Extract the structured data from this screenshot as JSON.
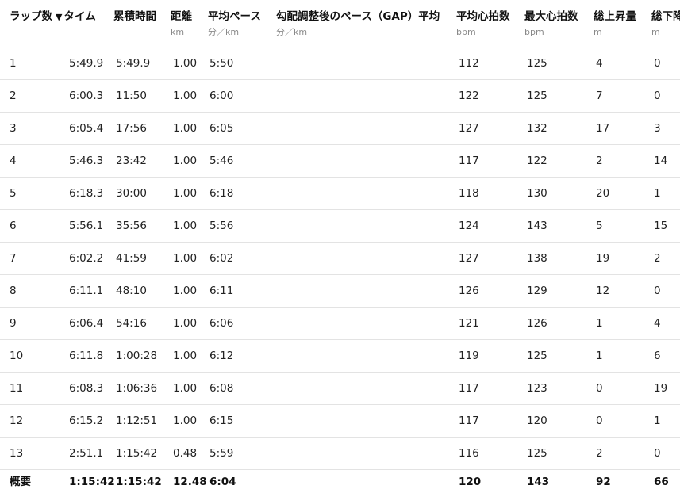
{
  "headers": [
    {
      "key": "lap",
      "label": "ラップ数",
      "unit": ""
    },
    {
      "key": "time",
      "label": "タイム",
      "unit": "",
      "sort_icon": "sort-down-icon",
      "sort_glyph": "▼"
    },
    {
      "key": "cumulative",
      "label": "累積時間",
      "unit": ""
    },
    {
      "key": "distance",
      "label": "距離",
      "unit": "km"
    },
    {
      "key": "avg_pace",
      "label": "平均ペース",
      "unit": "分／km"
    },
    {
      "key": "gap",
      "label": "勾配調整後のペース（GAP）平均",
      "unit": "分／km"
    },
    {
      "key": "avg_hr",
      "label": "平均心拍数",
      "unit": "bpm"
    },
    {
      "key": "max_hr",
      "label": "最大心拍数",
      "unit": "bpm"
    },
    {
      "key": "ascent",
      "label": "総上昇量",
      "unit": "m"
    },
    {
      "key": "descent",
      "label": "総下降量",
      "unit": "m"
    }
  ],
  "rows": [
    {
      "lap": "1",
      "time": "5:49.9",
      "cumulative": "5:49.9",
      "distance": "1.00",
      "avg_pace": "5:50",
      "gap": "",
      "avg_hr": "112",
      "max_hr": "125",
      "ascent": "4",
      "descent": "0"
    },
    {
      "lap": "2",
      "time": "6:00.3",
      "cumulative": "11:50",
      "distance": "1.00",
      "avg_pace": "6:00",
      "gap": "",
      "avg_hr": "122",
      "max_hr": "125",
      "ascent": "7",
      "descent": "0"
    },
    {
      "lap": "3",
      "time": "6:05.4",
      "cumulative": "17:56",
      "distance": "1.00",
      "avg_pace": "6:05",
      "gap": "",
      "avg_hr": "127",
      "max_hr": "132",
      "ascent": "17",
      "descent": "3"
    },
    {
      "lap": "4",
      "time": "5:46.3",
      "cumulative": "23:42",
      "distance": "1.00",
      "avg_pace": "5:46",
      "gap": "",
      "avg_hr": "117",
      "max_hr": "122",
      "ascent": "2",
      "descent": "14"
    },
    {
      "lap": "5",
      "time": "6:18.3",
      "cumulative": "30:00",
      "distance": "1.00",
      "avg_pace": "6:18",
      "gap": "",
      "avg_hr": "118",
      "max_hr": "130",
      "ascent": "20",
      "descent": "1"
    },
    {
      "lap": "6",
      "time": "5:56.1",
      "cumulative": "35:56",
      "distance": "1.00",
      "avg_pace": "5:56",
      "gap": "",
      "avg_hr": "124",
      "max_hr": "143",
      "ascent": "5",
      "descent": "15"
    },
    {
      "lap": "7",
      "time": "6:02.2",
      "cumulative": "41:59",
      "distance": "1.00",
      "avg_pace": "6:02",
      "gap": "",
      "avg_hr": "127",
      "max_hr": "138",
      "ascent": "19",
      "descent": "2"
    },
    {
      "lap": "8",
      "time": "6:11.1",
      "cumulative": "48:10",
      "distance": "1.00",
      "avg_pace": "6:11",
      "gap": "",
      "avg_hr": "126",
      "max_hr": "129",
      "ascent": "12",
      "descent": "0"
    },
    {
      "lap": "9",
      "time": "6:06.4",
      "cumulative": "54:16",
      "distance": "1.00",
      "avg_pace": "6:06",
      "gap": "",
      "avg_hr": "121",
      "max_hr": "126",
      "ascent": "1",
      "descent": "4"
    },
    {
      "lap": "10",
      "time": "6:11.8",
      "cumulative": "1:00:28",
      "distance": "1.00",
      "avg_pace": "6:12",
      "gap": "",
      "avg_hr": "119",
      "max_hr": "125",
      "ascent": "1",
      "descent": "6"
    },
    {
      "lap": "11",
      "time": "6:08.3",
      "cumulative": "1:06:36",
      "distance": "1.00",
      "avg_pace": "6:08",
      "gap": "",
      "avg_hr": "117",
      "max_hr": "123",
      "ascent": "0",
      "descent": "19"
    },
    {
      "lap": "12",
      "time": "6:15.2",
      "cumulative": "1:12:51",
      "distance": "1.00",
      "avg_pace": "6:15",
      "gap": "",
      "avg_hr": "117",
      "max_hr": "120",
      "ascent": "0",
      "descent": "1"
    },
    {
      "lap": "13",
      "time": "2:51.1",
      "cumulative": "1:15:42",
      "distance": "0.48",
      "avg_pace": "5:59",
      "gap": "",
      "avg_hr": "116",
      "max_hr": "125",
      "ascent": "2",
      "descent": "0"
    }
  ],
  "summary": {
    "lap": "概要",
    "time": "1:15:42",
    "cumulative": "1:15:42",
    "distance": "12.48",
    "avg_pace": "6:04",
    "gap": "",
    "avg_hr": "120",
    "max_hr": "143",
    "ascent": "92",
    "descent": "66"
  }
}
